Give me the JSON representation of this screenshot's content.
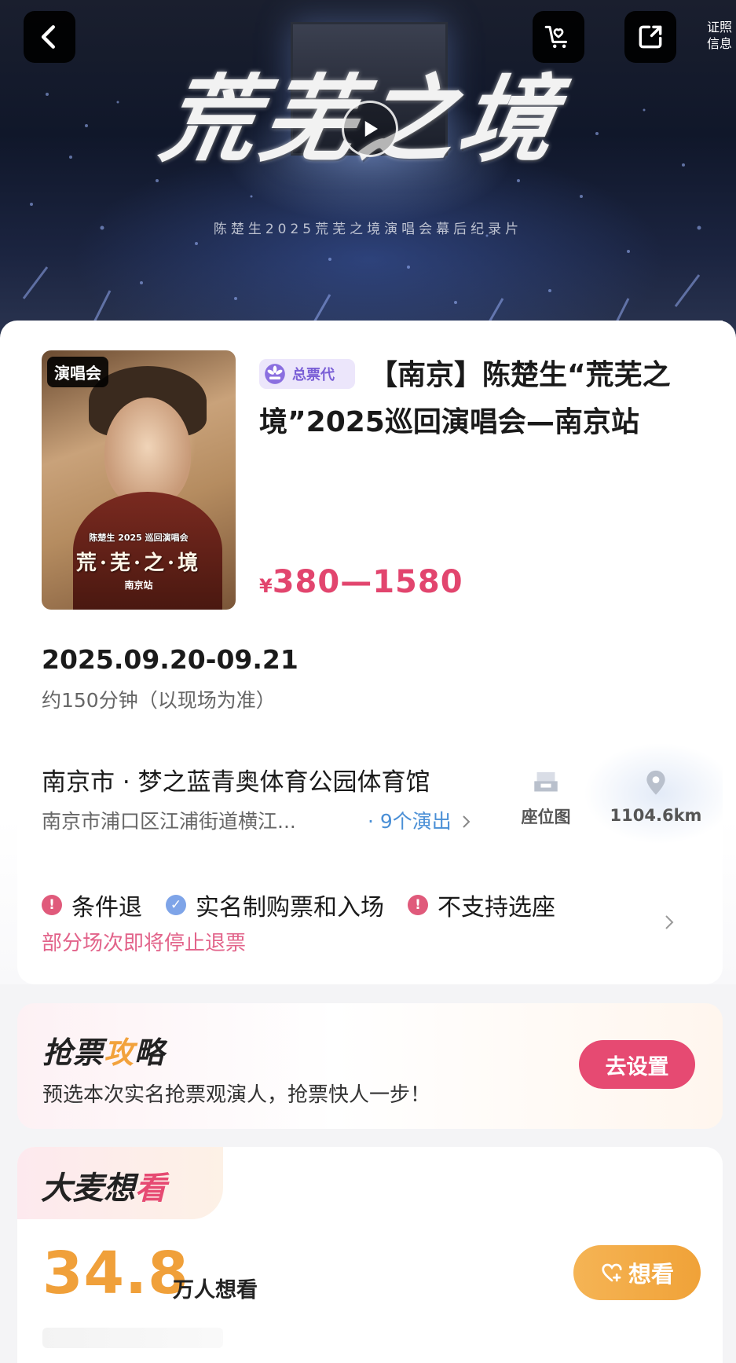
{
  "banner": {
    "calligraphy": "荒芜之境",
    "subtitle": "陈楚生2025荒芜之境演唱会幕后纪录片",
    "license_line1": "证照",
    "license_line2": "信息"
  },
  "poster": {
    "tag": "演唱会",
    "title": "荒·芜·之·境",
    "subtitle": "陈楚生 2025 巡回演唱会",
    "station": "南京站"
  },
  "event": {
    "agent_badge": "总票代",
    "title": "【南京】陈楚生“荒芜之境”2025巡回演唱会—南京站",
    "price_symbol": "¥",
    "price_range": "380—1580",
    "date": "2025.09.20-09.21",
    "duration": "约150分钟（以现场为准）",
    "venue": "南京市 · 梦之蓝青奥体育公园体育馆",
    "address": "南京市浦口区江浦街道横江...",
    "shows_link": "· 9个演出",
    "seat_map_label": "座位图",
    "distance": "1104.6km"
  },
  "policies": {
    "items": [
      {
        "label": "条件退",
        "icon": "warning"
      },
      {
        "label": "实名制购票和入场",
        "icon": "check"
      },
      {
        "label": "不支持选座",
        "icon": "warning"
      }
    ],
    "note": "部分场次即将停止退票"
  },
  "strategy": {
    "title_part1": "抢票",
    "title_part2": "攻",
    "title_part3": "略",
    "description": "预选本次实名抢票观演人，抢票快人一步！",
    "button": "去设置"
  },
  "wish": {
    "title_part1": "大麦想",
    "title_part2": "看",
    "count": "34.8",
    "unit": "万人想看",
    "button": "想看"
  },
  "colors": {
    "accent_pink": "#e64a72",
    "price": "#e2456e",
    "wish_orange": "#f0a03a",
    "link_blue": "#4a8fd6",
    "agent_purple": "#7a5fd6"
  }
}
